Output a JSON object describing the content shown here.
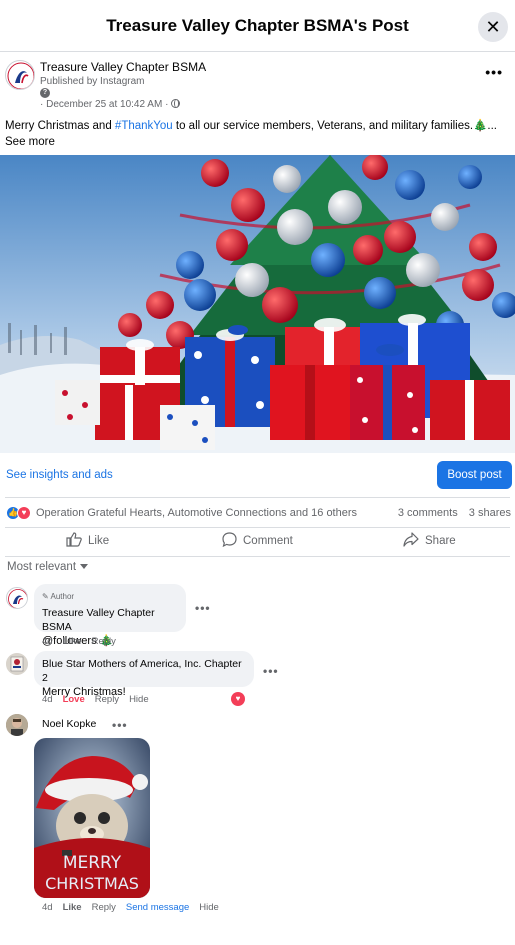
{
  "header": {
    "title": "Treasure Valley Chapter BSMA's Post",
    "close_icon": "close-icon"
  },
  "post": {
    "author": "Treasure Valley Chapter BSMA",
    "published_via": "Published by Instagram",
    "date": "· December 25 at 10:42 AM ·",
    "caption_before": "Merry Christmas and ",
    "caption_hashtag": "#ThankYou",
    "caption_after": " to all our service members, Veterans, and military families.🎄... See more",
    "image_icon": "christmas-tree-gifts-image"
  },
  "insights": {
    "link": "See insights and ads",
    "boost": "Boost post"
  },
  "reactions": {
    "names": "Operation Grateful Hearts, Automotive Connections and 16 others",
    "comments": "3 comments",
    "shares": "3 shares"
  },
  "actions": {
    "like": "Like",
    "comment": "Comment",
    "share": "Share"
  },
  "sort_label": "Most relevant",
  "comments": [
    {
      "badge": "Author",
      "name": "Treasure Valley Chapter BSMA",
      "text": "@followers 🎄",
      "time": "4d",
      "like": "Like",
      "reply": "Reply"
    },
    {
      "name": "Blue Star Mothers of America, Inc. Chapter 2",
      "text": "Merry Christmas!",
      "time": "4d",
      "reaction": "Love",
      "reply": "Reply",
      "hide": "Hide"
    },
    {
      "name": "Noel Kopke",
      "sticker_text_1": "MERRY",
      "sticker_text_2": "CHRISTMAS",
      "time": "4d",
      "like": "Like",
      "reply": "Reply",
      "send": "Send message",
      "hide": "Hide"
    }
  ],
  "colors": {
    "accent": "#1b74e4",
    "love": "#f33e58",
    "bubble": "#f0f2f5"
  }
}
